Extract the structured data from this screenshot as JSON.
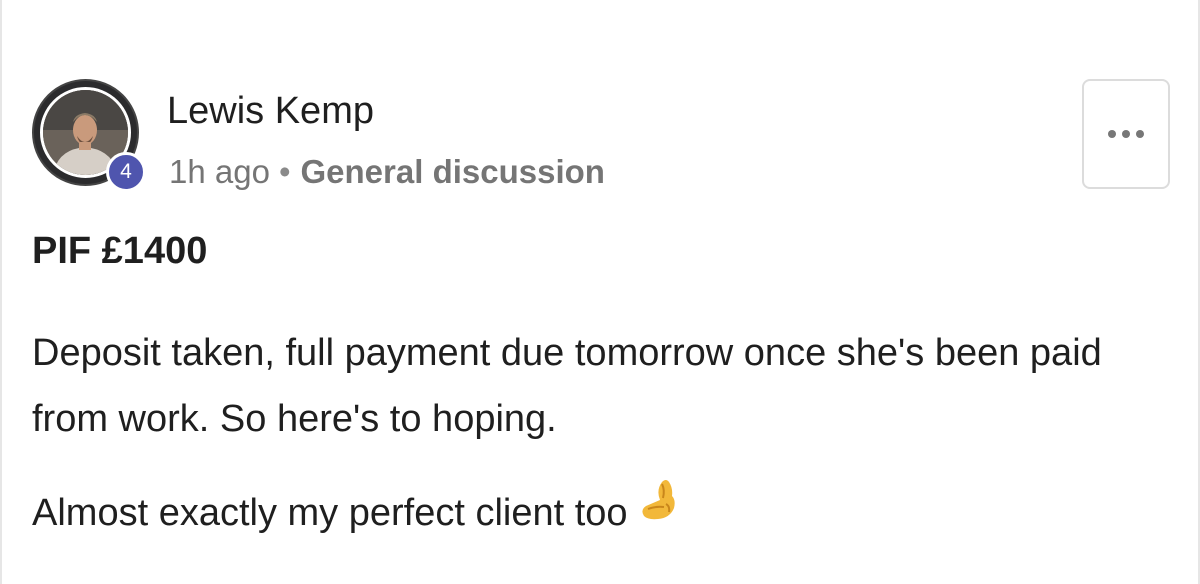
{
  "post": {
    "author": "Lewis Kemp",
    "level": "4",
    "time": "1h ago",
    "separator": "•",
    "category": "General discussion",
    "more_menu": "more-options",
    "title": "PIF £1400",
    "body": [
      "Deposit taken, full payment due tomorrow once she's been paid from work. So here's to hoping.",
      "Almost exactly my perfect client too"
    ],
    "emoji": "pinching-hand-icon"
  },
  "colors": {
    "badge": "#4f55ae",
    "meta_text": "#757575",
    "border": "#dcdcdc",
    "text": "#1f1f1f"
  }
}
